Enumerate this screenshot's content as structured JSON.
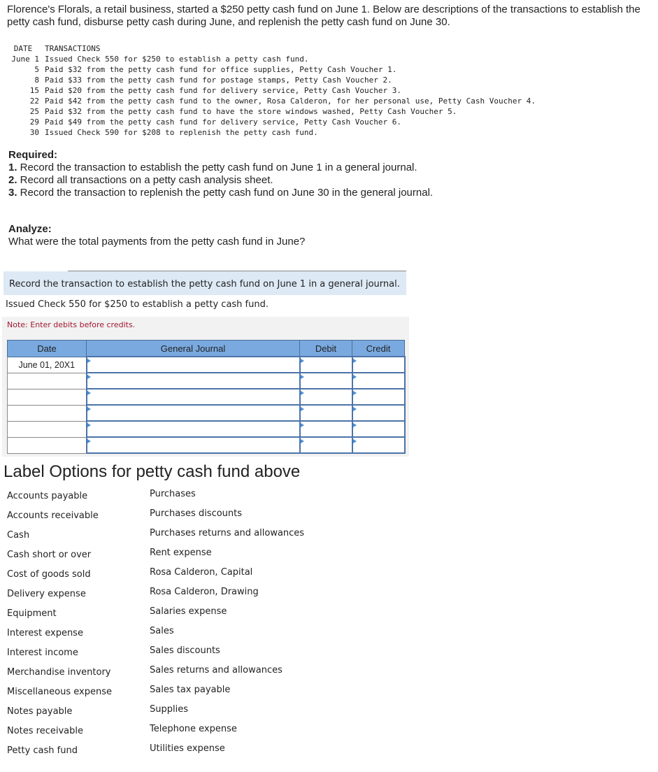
{
  "intro": "Florence's Florals, a retail business, started a $250 petty cash fund on June 1. Below are descriptions of the transactions to establish the petty cash fund, disburse petty cash during June, and replenish the petty cash fund on June 30.",
  "transactions": {
    "headers": [
      "DATE",
      "TRANSACTIONS"
    ],
    "rows": [
      {
        "date": "June 1",
        "text": "Issued Check 550 for $250 to establish a petty cash fund."
      },
      {
        "date": "5",
        "text": "Paid $32 from the petty cash fund for office supplies, Petty Cash Voucher 1."
      },
      {
        "date": "8",
        "text": "Paid $33 from the petty cash fund for postage stamps, Petty Cash Voucher 2."
      },
      {
        "date": "15",
        "text": "Paid $20 from the petty cash fund for delivery service, Petty Cash Voucher 3."
      },
      {
        "date": "22",
        "text": "Paid $42 from the petty cash fund to the owner, Rosa Calderon, for her personal use, Petty Cash Voucher 4."
      },
      {
        "date": "25",
        "text": "Paid $32 from the petty cash fund to have the store windows washed, Petty Cash Voucher 5."
      },
      {
        "date": "29",
        "text": "Paid $49 from the petty cash fund for delivery service, Petty Cash Voucher 6."
      },
      {
        "date": "30",
        "text": "Issued Check 590 for $208 to replenish the petty cash fund."
      }
    ]
  },
  "required": {
    "title": "Required:",
    "items": [
      {
        "num": "1.",
        "text": " Record the transaction to establish the petty cash fund on June 1 in a general journal."
      },
      {
        "num": "2.",
        "text": " Record all transactions on a petty cash analysis sheet."
      },
      {
        "num": "3.",
        "text": " Record the transaction to replenish the petty cash fund on June 30 in the general journal."
      }
    ]
  },
  "analyze": {
    "title": "Analyze:",
    "question": "What were the total payments from the petty cash fund in June?"
  },
  "task": {
    "instruction": "Record the transaction to establish the petty cash fund on June 1 in a general journal.",
    "description": "Issued Check 550 for $250 to establish a petty cash fund.",
    "note": "Note: Enter debits before credits."
  },
  "journal": {
    "headers": [
      "Date",
      "General Journal",
      "Debit",
      "Credit"
    ],
    "date": "June 01, 20X1"
  },
  "labels": {
    "title": "Label Options for petty cash fund above",
    "left": [
      "Accounts payable",
      "Accounts receivable",
      "Cash",
      "Cash short or over",
      "Cost of goods sold",
      "Delivery expense",
      "Equipment",
      "Interest expense",
      "Interest income",
      "Merchandise inventory",
      "Miscellaneous expense",
      "Notes payable",
      "Notes receivable",
      "Petty cash fund"
    ],
    "right": [
      "Purchases",
      "Purchases discounts",
      "Purchases returns and allowances",
      "Rent expense",
      "Rosa Calderon, Capital",
      "Rosa Calderon, Drawing",
      "Salaries expense",
      "Sales",
      "Sales discounts",
      "Sales returns and allowances",
      "Sales tax payable",
      "Supplies",
      "Telephone expense",
      "Utilities expense"
    ]
  }
}
